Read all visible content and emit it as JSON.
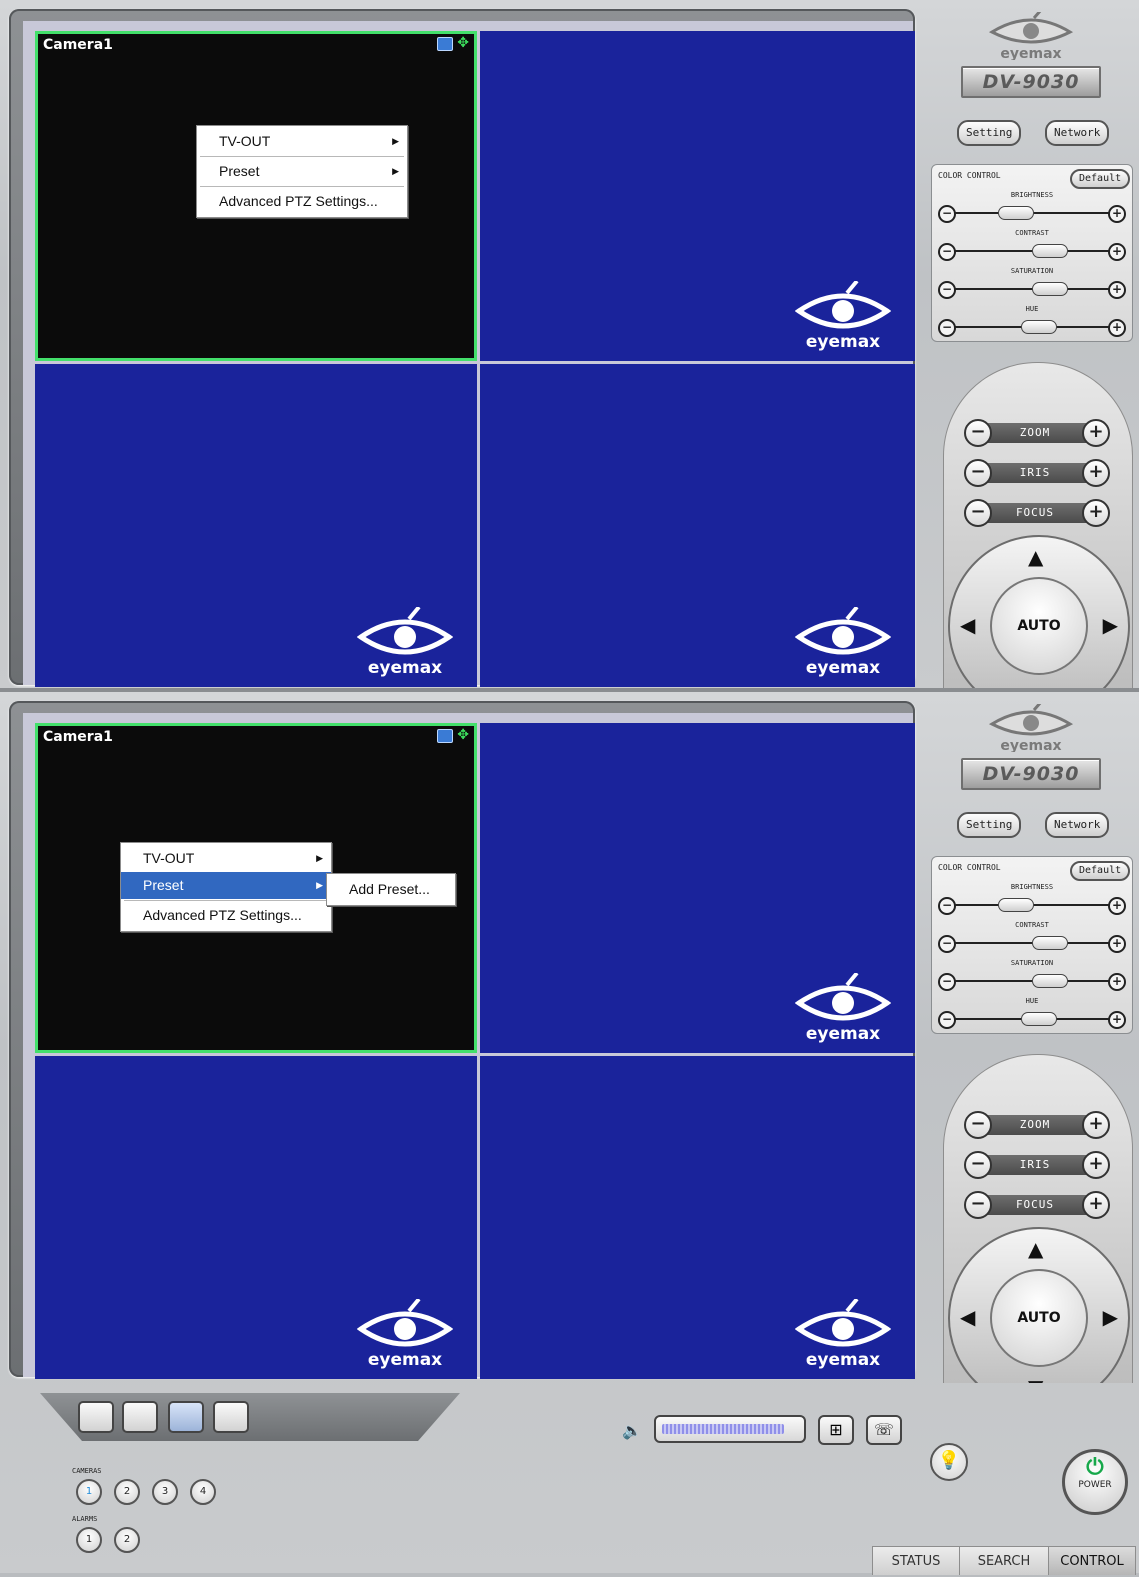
{
  "app": {
    "model": "DV-9030",
    "brand": "eyemax",
    "setting_label": "Setting",
    "network_label": "Network",
    "color_control": {
      "title": "COLOR CONTROL",
      "default_label": "Default",
      "rows": [
        {
          "label": "BRIGHTNESS",
          "level": 0.35
        },
        {
          "label": "CONTRAST",
          "level": 0.65
        },
        {
          "label": "SATURATION",
          "level": 0.65
        },
        {
          "label": "HUE",
          "level": 0.55
        }
      ]
    },
    "ptz": {
      "rows": [
        "ZOOM",
        "IRIS",
        "FOCUS"
      ],
      "auto_label": "AUTO"
    }
  },
  "camera": {
    "label": "Camera1"
  },
  "menu_top": {
    "items": [
      "TV-OUT",
      "Preset",
      "Advanced PTZ Settings..."
    ]
  },
  "menu_bottom": {
    "items": [
      "TV-OUT",
      "Preset",
      "Advanced PTZ Settings..."
    ],
    "highlighted_index": 1,
    "submenu": [
      "Add Preset..."
    ]
  },
  "bottom": {
    "cameras_label": "CAMERAS",
    "alarms_label": "ALARMS",
    "cameras": [
      "1",
      "2",
      "3",
      "4"
    ],
    "alarms": [
      "1",
      "2"
    ],
    "selected_camera_index": 0,
    "volume_level": 0.9,
    "power_label": "POWER",
    "tabs": [
      "STATUS",
      "SEARCH",
      "CONTROL"
    ],
    "active_tab_index": 2
  },
  "colors": {
    "selected_border": "#43e06b",
    "video_blue": "#1a239b",
    "menu_highlight": "#3168c0"
  }
}
